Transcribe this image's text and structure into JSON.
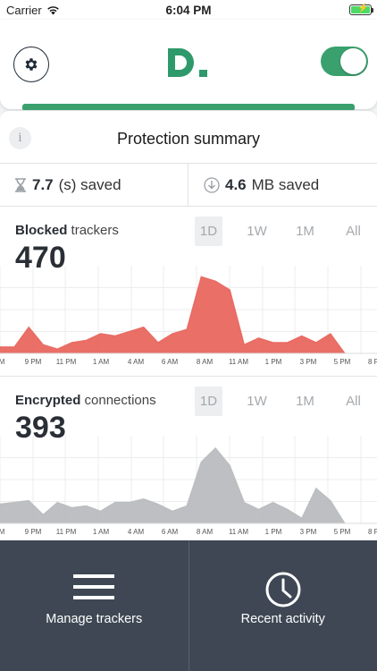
{
  "status_bar": {
    "carrier": "Carrier",
    "time": "6:04 PM"
  },
  "header": {
    "vpn_enabled": true,
    "accent_color": "#3aa06d"
  },
  "summary": {
    "title": "Protection summary",
    "info_icon": "i",
    "time_saved_value": "7.7",
    "time_saved_unit": "(s) saved",
    "data_saved_value": "4.6",
    "data_saved_unit": "MB saved"
  },
  "blocked_chart": {
    "label_bold": "Blocked",
    "label_rest": " trackers",
    "value": "470",
    "periods": [
      "1D",
      "1W",
      "1M",
      "All"
    ],
    "active_period": "1D"
  },
  "encrypted_chart": {
    "label_bold": "Encrypted",
    "label_rest": " connections",
    "value": "393",
    "periods": [
      "1D",
      "1W",
      "1M",
      "All"
    ],
    "active_period": "1D"
  },
  "chart_data": [
    {
      "type": "area",
      "title": "Blocked trackers",
      "color": "#e8675f",
      "x_ticks": [
        "M",
        "9 PM",
        "11 PM",
        "1 AM",
        "4 AM",
        "6 AM",
        "8 AM",
        "11 AM",
        "1 PM",
        "3 PM",
        "5 PM",
        "8 P"
      ],
      "values": [
        3,
        3,
        12,
        4,
        2,
        5,
        6,
        9,
        8,
        10,
        12,
        5,
        9,
        11,
        35,
        33,
        29,
        4,
        7,
        5,
        5,
        8,
        5,
        9,
        0
      ],
      "ylim": [
        0,
        40
      ]
    },
    {
      "type": "area",
      "title": "Encrypted connections",
      "color": "#b9bcbf",
      "x_ticks": [
        "M",
        "9 PM",
        "11 PM",
        "1 AM",
        "4 AM",
        "6 AM",
        "8 AM",
        "11 AM",
        "1 PM",
        "3 PM",
        "5 PM",
        "8 P"
      ],
      "values": [
        11,
        12,
        13,
        5,
        12,
        9,
        10,
        7,
        12,
        12,
        14,
        11,
        7,
        10,
        35,
        43,
        33,
        12,
        8,
        12,
        8,
        3,
        20,
        13,
        0
      ],
      "ylim": [
        0,
        50
      ]
    }
  ],
  "bottom_bar": {
    "manage_label": "Manage trackers",
    "activity_label": "Recent activity"
  }
}
